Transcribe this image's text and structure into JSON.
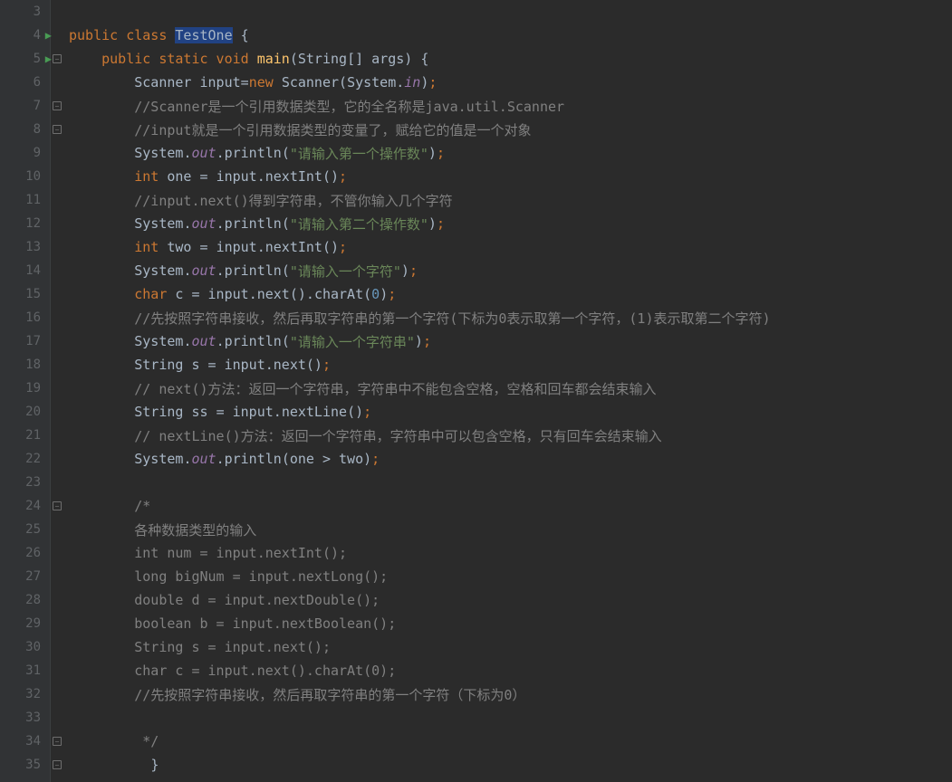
{
  "lines": [
    {
      "n": 3,
      "run": false,
      "fold": "",
      "tokens": []
    },
    {
      "n": 4,
      "run": true,
      "fold": "",
      "tokens": [
        {
          "cls": "kw",
          "t": "public class "
        },
        {
          "cls": "hl cls",
          "t": "TestOne"
        },
        {
          "cls": "pn",
          "t": " {"
        }
      ]
    },
    {
      "n": 5,
      "run": true,
      "fold": "open",
      "tokens": [
        {
          "cls": "",
          "t": "    "
        },
        {
          "cls": "kw",
          "t": "public static void "
        },
        {
          "cls": "method",
          "t": "main"
        },
        {
          "cls": "pn",
          "t": "("
        },
        {
          "cls": "id",
          "t": "String"
        },
        {
          "cls": "pn",
          "t": "[] "
        },
        {
          "cls": "param",
          "t": "args"
        },
        {
          "cls": "pn",
          "t": ") {"
        }
      ]
    },
    {
      "n": 6,
      "run": false,
      "fold": "",
      "tokens": [
        {
          "cls": "",
          "t": "        "
        },
        {
          "cls": "id",
          "t": "Scanner input"
        },
        {
          "cls": "pn",
          "t": "="
        },
        {
          "cls": "kw",
          "t": "new "
        },
        {
          "cls": "id",
          "t": "Scanner"
        },
        {
          "cls": "pn",
          "t": "("
        },
        {
          "cls": "id",
          "t": "System"
        },
        {
          "cls": "pn",
          "t": "."
        },
        {
          "cls": "field",
          "t": "in"
        },
        {
          "cls": "pn",
          "t": ")"
        },
        {
          "cls": "kw",
          "t": ";"
        }
      ]
    },
    {
      "n": 7,
      "run": false,
      "fold": "open",
      "tokens": [
        {
          "cls": "",
          "t": "        "
        },
        {
          "cls": "cmt",
          "t": "//Scanner是一个引用数据类型，它的全名称是java.util.Scanner"
        }
      ]
    },
    {
      "n": 8,
      "run": false,
      "fold": "close",
      "tokens": [
        {
          "cls": "",
          "t": "        "
        },
        {
          "cls": "cmt",
          "t": "//input就是一个引用数据类型的变量了，赋给它的值是一个对象"
        }
      ]
    },
    {
      "n": 9,
      "run": false,
      "fold": "",
      "tokens": [
        {
          "cls": "",
          "t": "        "
        },
        {
          "cls": "id",
          "t": "System"
        },
        {
          "cls": "pn",
          "t": "."
        },
        {
          "cls": "field",
          "t": "out"
        },
        {
          "cls": "pn",
          "t": "."
        },
        {
          "cls": "id",
          "t": "println"
        },
        {
          "cls": "pn",
          "t": "("
        },
        {
          "cls": "str",
          "t": "\"请输入第一个操作数\""
        },
        {
          "cls": "pn",
          "t": ")"
        },
        {
          "cls": "kw",
          "t": ";"
        }
      ]
    },
    {
      "n": 10,
      "run": false,
      "fold": "",
      "tokens": [
        {
          "cls": "",
          "t": "        "
        },
        {
          "cls": "kw",
          "t": "int "
        },
        {
          "cls": "id",
          "t": "one "
        },
        {
          "cls": "pn",
          "t": "= "
        },
        {
          "cls": "id",
          "t": "input"
        },
        {
          "cls": "pn",
          "t": "."
        },
        {
          "cls": "id",
          "t": "nextInt"
        },
        {
          "cls": "pn",
          "t": "()"
        },
        {
          "cls": "kw",
          "t": ";"
        }
      ]
    },
    {
      "n": 11,
      "run": false,
      "fold": "",
      "tokens": [
        {
          "cls": "",
          "t": "        "
        },
        {
          "cls": "cmt",
          "t": "//input.next()得到字符串，不管你输入几个字符"
        }
      ]
    },
    {
      "n": 12,
      "run": false,
      "fold": "",
      "tokens": [
        {
          "cls": "",
          "t": "        "
        },
        {
          "cls": "id",
          "t": "System"
        },
        {
          "cls": "pn",
          "t": "."
        },
        {
          "cls": "field",
          "t": "out"
        },
        {
          "cls": "pn",
          "t": "."
        },
        {
          "cls": "id",
          "t": "println"
        },
        {
          "cls": "pn",
          "t": "("
        },
        {
          "cls": "str",
          "t": "\"请输入第二个操作数\""
        },
        {
          "cls": "pn",
          "t": ")"
        },
        {
          "cls": "kw",
          "t": ";"
        }
      ]
    },
    {
      "n": 13,
      "run": false,
      "fold": "",
      "tokens": [
        {
          "cls": "",
          "t": "        "
        },
        {
          "cls": "kw",
          "t": "int "
        },
        {
          "cls": "id",
          "t": "two "
        },
        {
          "cls": "pn",
          "t": "= "
        },
        {
          "cls": "id",
          "t": "input"
        },
        {
          "cls": "pn",
          "t": "."
        },
        {
          "cls": "id",
          "t": "nextInt"
        },
        {
          "cls": "pn",
          "t": "()"
        },
        {
          "cls": "kw",
          "t": ";"
        }
      ]
    },
    {
      "n": 14,
      "run": false,
      "fold": "",
      "tokens": [
        {
          "cls": "",
          "t": "        "
        },
        {
          "cls": "id",
          "t": "System"
        },
        {
          "cls": "pn",
          "t": "."
        },
        {
          "cls": "field",
          "t": "out"
        },
        {
          "cls": "pn",
          "t": "."
        },
        {
          "cls": "id",
          "t": "println"
        },
        {
          "cls": "pn",
          "t": "("
        },
        {
          "cls": "str",
          "t": "\"请输入一个字符\""
        },
        {
          "cls": "pn",
          "t": ")"
        },
        {
          "cls": "kw",
          "t": ";"
        }
      ]
    },
    {
      "n": 15,
      "run": false,
      "fold": "",
      "tokens": [
        {
          "cls": "",
          "t": "        "
        },
        {
          "cls": "kw",
          "t": "char "
        },
        {
          "cls": "id",
          "t": "c "
        },
        {
          "cls": "pn",
          "t": "= "
        },
        {
          "cls": "id",
          "t": "input"
        },
        {
          "cls": "pn",
          "t": "."
        },
        {
          "cls": "id",
          "t": "next"
        },
        {
          "cls": "pn",
          "t": "()."
        },
        {
          "cls": "id",
          "t": "charAt"
        },
        {
          "cls": "pn",
          "t": "("
        },
        {
          "cls": "num",
          "t": "0"
        },
        {
          "cls": "pn",
          "t": ")"
        },
        {
          "cls": "kw",
          "t": ";"
        }
      ]
    },
    {
      "n": 16,
      "run": false,
      "fold": "",
      "tokens": [
        {
          "cls": "",
          "t": "        "
        },
        {
          "cls": "cmt",
          "t": "//先按照字符串接收，然后再取字符串的第一个字符(下标为0表示取第一个字符，(1)表示取第二个字符)"
        }
      ]
    },
    {
      "n": 17,
      "run": false,
      "fold": "",
      "tokens": [
        {
          "cls": "",
          "t": "        "
        },
        {
          "cls": "id",
          "t": "System"
        },
        {
          "cls": "pn",
          "t": "."
        },
        {
          "cls": "field",
          "t": "out"
        },
        {
          "cls": "pn",
          "t": "."
        },
        {
          "cls": "id",
          "t": "println"
        },
        {
          "cls": "pn",
          "t": "("
        },
        {
          "cls": "str",
          "t": "\"请输入一个字符串\""
        },
        {
          "cls": "pn",
          "t": ")"
        },
        {
          "cls": "kw",
          "t": ";"
        }
      ]
    },
    {
      "n": 18,
      "run": false,
      "fold": "",
      "tokens": [
        {
          "cls": "",
          "t": "        "
        },
        {
          "cls": "id",
          "t": "String s "
        },
        {
          "cls": "pn",
          "t": "= "
        },
        {
          "cls": "id",
          "t": "input"
        },
        {
          "cls": "pn",
          "t": "."
        },
        {
          "cls": "id",
          "t": "next"
        },
        {
          "cls": "pn",
          "t": "()"
        },
        {
          "cls": "kw",
          "t": ";"
        }
      ]
    },
    {
      "n": 19,
      "run": false,
      "fold": "",
      "tokens": [
        {
          "cls": "",
          "t": "        "
        },
        {
          "cls": "cmt",
          "t": "// next()方法：返回一个字符串，字符串中不能包含空格，空格和回车都会结束输入"
        }
      ]
    },
    {
      "n": 20,
      "run": false,
      "fold": "",
      "tokens": [
        {
          "cls": "",
          "t": "        "
        },
        {
          "cls": "id",
          "t": "String ss "
        },
        {
          "cls": "pn",
          "t": "= "
        },
        {
          "cls": "id",
          "t": "input"
        },
        {
          "cls": "pn",
          "t": "."
        },
        {
          "cls": "id",
          "t": "nextLine"
        },
        {
          "cls": "pn",
          "t": "()"
        },
        {
          "cls": "kw",
          "t": ";"
        }
      ]
    },
    {
      "n": 21,
      "run": false,
      "fold": "",
      "tokens": [
        {
          "cls": "",
          "t": "        "
        },
        {
          "cls": "cmt",
          "t": "// nextLine()方法：返回一个字符串，字符串中可以包含空格，只有回车会结束输入"
        }
      ]
    },
    {
      "n": 22,
      "run": false,
      "fold": "",
      "tokens": [
        {
          "cls": "",
          "t": "        "
        },
        {
          "cls": "id",
          "t": "System"
        },
        {
          "cls": "pn",
          "t": "."
        },
        {
          "cls": "field",
          "t": "out"
        },
        {
          "cls": "pn",
          "t": "."
        },
        {
          "cls": "id",
          "t": "println"
        },
        {
          "cls": "pn",
          "t": "("
        },
        {
          "cls": "id",
          "t": "one "
        },
        {
          "cls": "pn",
          "t": "> "
        },
        {
          "cls": "id",
          "t": "two"
        },
        {
          "cls": "pn",
          "t": ")"
        },
        {
          "cls": "kw",
          "t": ";"
        }
      ]
    },
    {
      "n": 23,
      "run": false,
      "fold": "",
      "tokens": []
    },
    {
      "n": 24,
      "run": false,
      "fold": "open",
      "tokens": [
        {
          "cls": "",
          "t": "        "
        },
        {
          "cls": "cmt",
          "t": "/*"
        }
      ]
    },
    {
      "n": 25,
      "run": false,
      "fold": "",
      "tokens": [
        {
          "cls": "",
          "t": "        "
        },
        {
          "cls": "cmt",
          "t": "各种数据类型的输入"
        }
      ]
    },
    {
      "n": 26,
      "run": false,
      "fold": "",
      "tokens": [
        {
          "cls": "",
          "t": "        "
        },
        {
          "cls": "cmt",
          "t": "int num = input.nextInt();"
        }
      ]
    },
    {
      "n": 27,
      "run": false,
      "fold": "",
      "tokens": [
        {
          "cls": "",
          "t": "        "
        },
        {
          "cls": "cmt",
          "t": "long bigNum = input.nextLong();"
        }
      ]
    },
    {
      "n": 28,
      "run": false,
      "fold": "",
      "tokens": [
        {
          "cls": "",
          "t": "        "
        },
        {
          "cls": "cmt",
          "t": "double d = input.nextDouble();"
        }
      ]
    },
    {
      "n": 29,
      "run": false,
      "fold": "",
      "tokens": [
        {
          "cls": "",
          "t": "        "
        },
        {
          "cls": "cmt",
          "t": "boolean b = input.nextBoolean();"
        }
      ]
    },
    {
      "n": 30,
      "run": false,
      "fold": "",
      "tokens": [
        {
          "cls": "",
          "t": "        "
        },
        {
          "cls": "cmt",
          "t": "String s = input.next();"
        }
      ]
    },
    {
      "n": 31,
      "run": false,
      "fold": "",
      "tokens": [
        {
          "cls": "",
          "t": "        "
        },
        {
          "cls": "cmt",
          "t": "char c = input.next().charAt(0);"
        }
      ]
    },
    {
      "n": 32,
      "run": false,
      "fold": "",
      "tokens": [
        {
          "cls": "",
          "t": "        "
        },
        {
          "cls": "cmt",
          "t": "//先按照字符串接收，然后再取字符串的第一个字符（下标为0）"
        }
      ]
    },
    {
      "n": 33,
      "run": false,
      "fold": "",
      "tokens": []
    },
    {
      "n": 34,
      "run": false,
      "fold": "close",
      "tokens": [
        {
          "cls": "",
          "t": "         "
        },
        {
          "cls": "cmt",
          "t": "*/"
        }
      ]
    },
    {
      "n": 35,
      "run": false,
      "fold": "close",
      "tokens": [
        {
          "cls": "",
          "t": "          "
        },
        {
          "cls": "pn",
          "t": "}"
        }
      ]
    }
  ]
}
